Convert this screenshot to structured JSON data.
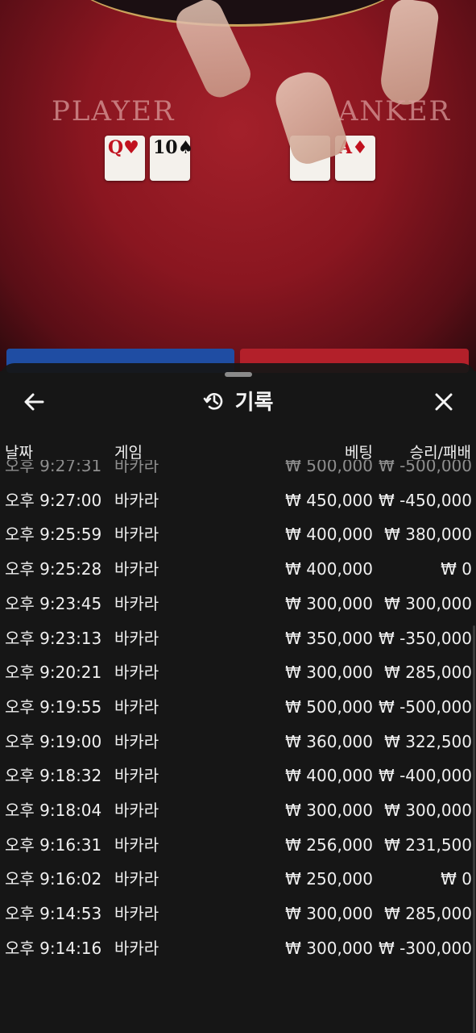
{
  "table": {
    "player_label": "PLAYER",
    "banker_label": "ANKER",
    "player_cards": [
      {
        "rank": "Q",
        "suit": "♥",
        "color": "red"
      },
      {
        "rank": "10",
        "suit": "♠",
        "color": "black"
      }
    ],
    "banker_cards": [
      {
        "rank": "",
        "suit": "",
        "color": "black"
      },
      {
        "rank": "A",
        "suit": "♦",
        "color": "red"
      }
    ]
  },
  "header": {
    "title": "기록",
    "back_icon": "arrow-left-icon",
    "history_icon": "history-clock-icon",
    "close_icon": "close-icon"
  },
  "columns": {
    "date": "날짜",
    "game": "게임",
    "bet": "베팅",
    "result": "승리/패배"
  },
  "records": [
    {
      "date": "오후 9:27:31",
      "game": "바카라",
      "bet": "₩ 500,000",
      "result": "₩ -500,000"
    },
    {
      "date": "오후 9:27:00",
      "game": "바카라",
      "bet": "₩ 450,000",
      "result": "₩ -450,000"
    },
    {
      "date": "오후 9:25:59",
      "game": "바카라",
      "bet": "₩ 400,000",
      "result": "₩ 380,000"
    },
    {
      "date": "오후 9:25:28",
      "game": "바카라",
      "bet": "₩ 400,000",
      "result": "₩ 0"
    },
    {
      "date": "오후 9:23:45",
      "game": "바카라",
      "bet": "₩ 300,000",
      "result": "₩ 300,000"
    },
    {
      "date": "오후 9:23:13",
      "game": "바카라",
      "bet": "₩ 350,000",
      "result": "₩ -350,000"
    },
    {
      "date": "오후 9:20:21",
      "game": "바카라",
      "bet": "₩ 300,000",
      "result": "₩ 285,000"
    },
    {
      "date": "오후 9:19:55",
      "game": "바카라",
      "bet": "₩ 500,000",
      "result": "₩ -500,000"
    },
    {
      "date": "오후 9:19:00",
      "game": "바카라",
      "bet": "₩ 360,000",
      "result": "₩ 322,500"
    },
    {
      "date": "오후 9:18:32",
      "game": "바카라",
      "bet": "₩ 400,000",
      "result": "₩ -400,000"
    },
    {
      "date": "오후 9:18:04",
      "game": "바카라",
      "bet": "₩ 300,000",
      "result": "₩ 300,000"
    },
    {
      "date": "오후 9:16:31",
      "game": "바카라",
      "bet": "₩ 256,000",
      "result": "₩ 231,500"
    },
    {
      "date": "오후 9:16:02",
      "game": "바카라",
      "bet": "₩ 250,000",
      "result": "₩ 0"
    },
    {
      "date": "오후 9:14:53",
      "game": "바카라",
      "bet": "₩ 300,000",
      "result": "₩ 285,000"
    },
    {
      "date": "오후 9:14:16",
      "game": "바카라",
      "bet": "₩ 300,000",
      "result": "₩ -300,000"
    }
  ]
}
